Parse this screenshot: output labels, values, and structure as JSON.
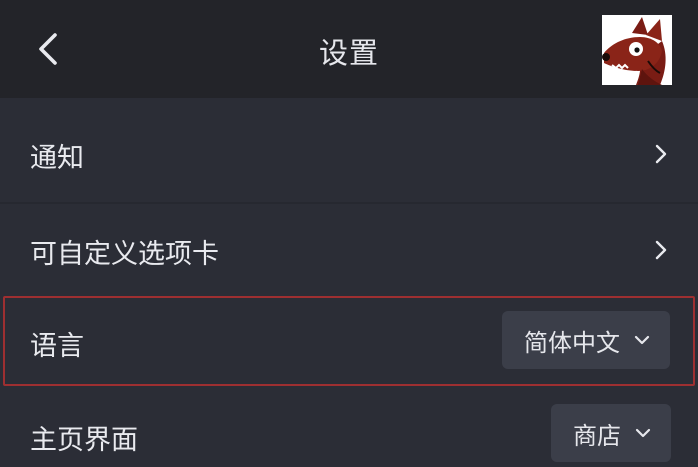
{
  "header": {
    "title": "设置",
    "back_icon": "chevron-left-icon",
    "avatar_icon": "cartoon-wolf-avatar"
  },
  "settings": {
    "notifications_label": "通知",
    "custom_tabs_label": "可自定义选项卡",
    "language_label": "语言",
    "language_value": "简体中文",
    "home_label": "主页界面",
    "home_value": "商店"
  },
  "colors": {
    "background": "#2b2d36",
    "header_background": "#232429",
    "dropdown_background": "#3b3e49",
    "highlight_border": "#9e2f31",
    "text": "#e9eaef"
  }
}
